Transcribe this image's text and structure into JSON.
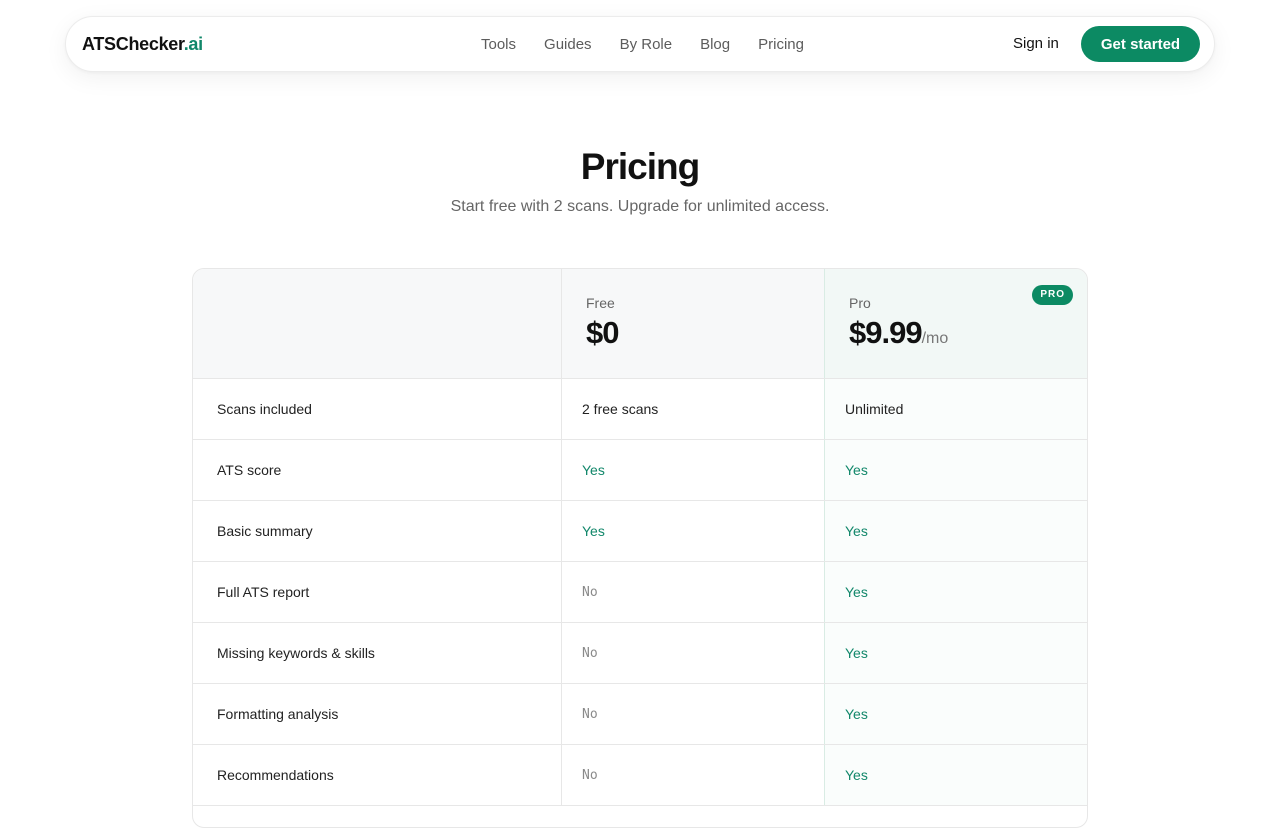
{
  "nav": {
    "brand_main": "ATSChecker",
    "brand_accent": ".ai",
    "links": [
      "Tools",
      "Guides",
      "By Role",
      "Blog",
      "Pricing"
    ],
    "signin_label": "Sign in",
    "cta_label": "Get started"
  },
  "hero": {
    "title": "Pricing",
    "subtitle": "Start free with 2 scans. Upgrade for unlimited access."
  },
  "plans": {
    "free": {
      "name": "Free",
      "price": "$0",
      "period": ""
    },
    "pro": {
      "name": "Pro",
      "price": "$9.99",
      "period": "/mo",
      "badge": "PRO"
    }
  },
  "rows": [
    {
      "feature": "Scans included",
      "free": "2 free scans",
      "free_kind": "text",
      "pro": "Unlimited",
      "pro_kind": "text"
    },
    {
      "feature": "ATS score",
      "free": "Yes",
      "free_kind": "yes",
      "pro": "Yes",
      "pro_kind": "yes"
    },
    {
      "feature": "Basic summary",
      "free": "Yes",
      "free_kind": "yes",
      "pro": "Yes",
      "pro_kind": "yes"
    },
    {
      "feature": "Full ATS report",
      "free": "No",
      "free_kind": "no",
      "pro": "Yes",
      "pro_kind": "yes"
    },
    {
      "feature": "Missing keywords & skills",
      "free": "No",
      "free_kind": "no",
      "pro": "Yes",
      "pro_kind": "yes"
    },
    {
      "feature": "Formatting analysis",
      "free": "No",
      "free_kind": "no",
      "pro": "Yes",
      "pro_kind": "yes"
    },
    {
      "feature": "Recommendations",
      "free": "No",
      "free_kind": "no",
      "pro": "Yes",
      "pro_kind": "yes"
    }
  ],
  "colors": {
    "accent": "#0c8a63",
    "yes_text": "#11876a",
    "no_text": "#8a8a8a"
  }
}
